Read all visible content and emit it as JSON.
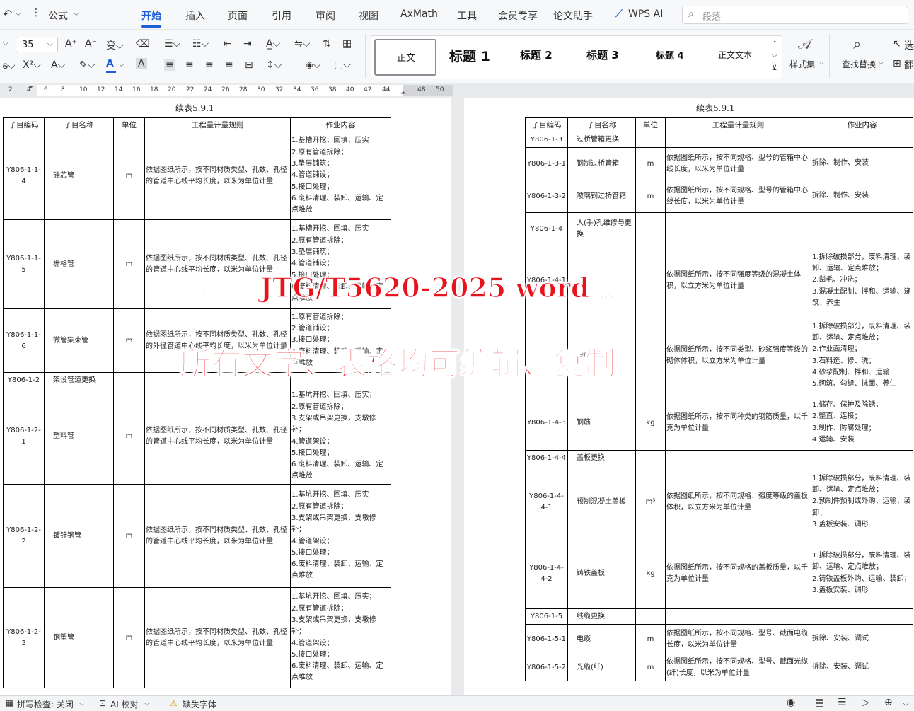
{
  "menubar": {
    "undo_icon": "↶",
    "formula_label": "公式",
    "tabs": [
      "开始",
      "插入",
      "页面",
      "引用",
      "审阅",
      "视图",
      "AxMath",
      "工具",
      "会员专享",
      "论文助手"
    ],
    "active_tab": "开始",
    "wps_ai": "WPS AI",
    "search_placeholder": "段落"
  },
  "ribbon": {
    "font_size": "35",
    "styles": [
      "正文",
      "标题 1",
      "标题 2",
      "标题 3",
      "标题 4",
      "正文文本"
    ],
    "style_set": "样式集",
    "find_replace": "查找替换",
    "select_label": "选",
    "translate_label": "翻",
    "accent_color": "#1f5fd6",
    "font_color_bar": "#1f5fd6"
  },
  "ruler": {
    "ticks": [
      "2",
      "4",
      "6",
      "8",
      "10",
      "12",
      "14",
      "16",
      "18",
      "20",
      "22",
      "24",
      "26",
      "28",
      "30",
      "32",
      "34",
      "36",
      "38",
      "40",
      "42",
      "44",
      "48",
      "50"
    ]
  },
  "page1": {
    "caption": "续表5.9.1",
    "headers": [
      "子目编码",
      "子目名称",
      "单位",
      "工程量计量规则",
      "作业内容"
    ],
    "rows": [
      {
        "code": "Y806-1-1-4",
        "name": "硅芯管",
        "unit": "m",
        "rule": "依据图纸所示，按不同材质类型、孔数、孔径的管道中心线平均长度，以米为单位计量",
        "work": "1.基槽开挖、回填、压实\n2.原有管道拆除；\n3.垫层铺筑；\n4.管道铺设；\n5.接口处理；\n6.废料清理、装卸、运输、定点堆放"
      },
      {
        "code": "Y806-1-1-5",
        "name": "栅格管",
        "unit": "m",
        "rule": "依据图纸所示，按不同材质类型、孔数、孔径的管道中心线平均长度，以米为单位计量",
        "work": "1.基槽开挖、回填、压实\n2.原有管道拆除；\n3.垫层铺筑；\n4.管道铺设；\n5.接口处理；\n6.废料清理、装卸、运输、定点堆放"
      },
      {
        "code": "Y806-1-1-6",
        "name": "微管集束管",
        "unit": "m",
        "rule": "依据图纸所示，按不同材质类型、孔数、孔径的外径管道中心线平均长度，以米为单位计量",
        "work": "1.原有管道拆除；\n2.管道铺设；\n3.接口处理；\n4.废料清理、装卸、运输、定点堆放"
      },
      {
        "code": "Y806-1-2",
        "name": "架设管道更换",
        "unit": "",
        "rule": "",
        "work": ""
      },
      {
        "code": "Y806-1-2-1",
        "name": "塑料管",
        "unit": "m",
        "rule": "依据图纸所示，按不同材质类型、孔数、孔径的管道中心线平均长度，以米为单位计量",
        "work": "1.基坑开挖、回填、压实；\n2.原有管道拆除；\n3.支架或吊架更换，支墩修补；\n4.管道架设；\n5.接口处理；\n6.废料清理、装卸、运输、定点堆放"
      },
      {
        "code": "Y806-1-2-2",
        "name": "镀锌钢管",
        "unit": "m",
        "rule": "依据图纸所示，按不同材质类型、孔数、孔径的管道中心线平均长度，以米为单位计量",
        "work": "1.基坑开挖、回填、压实\n2.原有管道拆除；\n3.支架或吊架更换，支墩修补；\n4.管道架设；\n5.接口处理；\n6.废料清理、装卸、运输、定点堆放"
      },
      {
        "code": "Y806-1-2-3",
        "name": "钢塑管",
        "unit": "m",
        "rule": "依据图纸所示，按不同材质类型、孔数、孔径的管道中心线平均长度，以米为单位计量",
        "work": "1.基坑开挖、回填、压实；\n2.原有管道拆除；\n3.支架或吊架更换，支墩修补；\n4.管道架设；\n5.接口处理；\n6.废料清理、装卸、运输、定点堆放"
      }
    ]
  },
  "page2": {
    "caption": "续表5.9.1",
    "headers": [
      "子目编码",
      "子目名称",
      "单位",
      "工程量计量规则",
      "作业内容"
    ],
    "rows": [
      {
        "code": "Y806-1-3",
        "name": "过桥管箱更换",
        "unit": "",
        "rule": "",
        "work": ""
      },
      {
        "code": "Y806-1-3-1",
        "name": "钢制过桥管箱",
        "unit": "m",
        "rule": "依据图纸所示，按不同规格、型号的管箱中心线长度，以米为单位计量",
        "work": "拆除、制作、安装"
      },
      {
        "code": "Y806-1-3-2",
        "name": "玻璃钢过桥管箱",
        "unit": "m",
        "rule": "依据图纸所示，按不同规格、型号的管箱中心线长度，以米为单位计量",
        "work": "拆除、制作、安装"
      },
      {
        "code": "Y806-1-4",
        "name": "人(手)孔维修与更换",
        "unit": "",
        "rule": "",
        "work": ""
      },
      {
        "code": "Y806-1-4-1",
        "name": "",
        "unit": "",
        "rule": "依据图纸所示，按不同强度等级的混凝土体积，以立方米为单位计量",
        "work": "1.拆除破损部分，废料清理、装卸、运输、定点堆放；\n2.凿毛、冲洗；\n3.混凝土配制、拌和、运输、浇筑、养生"
      },
      {
        "code": "",
        "name": "砖(石)砌",
        "unit": "",
        "rule": "依据图纸所示，按不同类型、砂浆强度等级的砌体体积，以立方米为单位计量",
        "work": "1.拆除破损部分，废料清理、装卸、运输、定点堆放；\n2.作业面清理；\n3.石料选、修、洗；\n4.砂浆配制、拌和、运输\n5.砌筑、勾缝、抹面、养生"
      },
      {
        "code": "Y806-1-4-3",
        "name": "钢筋",
        "unit": "kg",
        "rule": "依据图纸所示，按不同种类的钢筋质量，以千克为单位计量",
        "work": "1.储存、保护及除锈；\n2.整直、连接；\n3.制作、防腐处理；\n4.运输、安装"
      },
      {
        "code": "Y806-1-4-4",
        "name": "盖板更换",
        "unit": "",
        "rule": "",
        "work": ""
      },
      {
        "code": "Y806-1-4-4-1",
        "name": "预制混凝土盖板",
        "unit": "m³",
        "rule": "依据图纸所示，按不同规格、强度等级的盖板体积，以立方米为单位计量",
        "work": "1.拆除破损部分，废料清理、装卸、运输、定点堆放；\n2.预制件预制或外购、运输、装卸；\n3.盖板安装、调形"
      },
      {
        "code": "Y806-1-4-4-2",
        "name": "铸铁盖板",
        "unit": "kg",
        "rule": "依据图纸所示，按不同规格的盖板质量，以千克为单位计量",
        "work": "1.拆除破损部分，废料清理、装卸、运输、定点堆放；\n2.铸铁盖板外购、运输、装卸；\n3.盖板安装、调形"
      },
      {
        "code": "Y806-1-5",
        "name": "线缆更换",
        "unit": "",
        "rule": "",
        "work": ""
      },
      {
        "code": "Y806-1-5-1",
        "name": "电缆",
        "unit": "m",
        "rule": "依据图纸所示，按不同规格、型号、截面电缆长度，以米为单位计量",
        "work": "拆除、安装、调试"
      },
      {
        "code": "Y806-1-5-2",
        "name": "光缆(纤)",
        "unit": "m",
        "rule": "依据图纸所示，按不同规格、型号、截面光缆(纤)长度，以米为单位计量",
        "work": "拆除、安装、调试"
      }
    ]
  },
  "overlay": {
    "line1": "附赠 JTG/T5620-2025 word版",
    "line2": "所有文字、表格均可编辑、复制",
    "color": "#e8141b"
  },
  "statusbar": {
    "spellcheck": "拼写检查: 关闭",
    "ai_check": "AI 校对",
    "missing_font": "缺失字体"
  }
}
